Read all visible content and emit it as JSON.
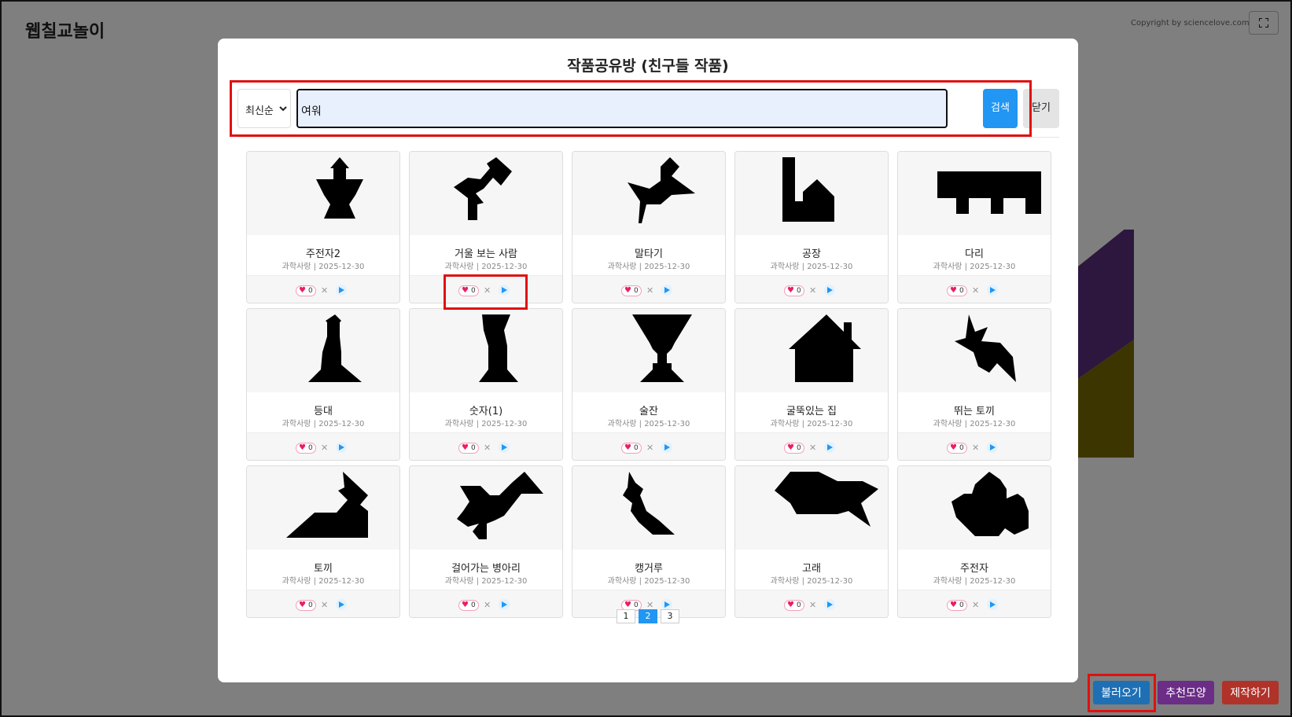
{
  "app": {
    "title": "웹칠교놀이",
    "copyright": "Copyright by sciencelove.com"
  },
  "bottom_buttons": {
    "load": "불러오기",
    "recommend": "추천모양",
    "make": "제작하기"
  },
  "modal": {
    "title": "작품공유방 (친구들 작품)",
    "sort_selected": "최신순",
    "search_value": "여워",
    "search_button": "검색",
    "close_button": "닫기"
  },
  "cards": [
    {
      "title": "주전자2",
      "author": "과학사랑",
      "date": "2025-12-30",
      "likes": "0",
      "icon": "shape-kettle2"
    },
    {
      "title": "거울 보는 사람",
      "author": "과학사랑",
      "date": "2025-12-30",
      "likes": "0",
      "icon": "shape-mirror-person"
    },
    {
      "title": "말타기",
      "author": "과학사랑",
      "date": "2025-12-30",
      "likes": "0",
      "icon": "shape-horse-riding"
    },
    {
      "title": "공장",
      "author": "과학사랑",
      "date": "2025-12-30",
      "likes": "0",
      "icon": "shape-factory"
    },
    {
      "title": "다리",
      "author": "과학사랑",
      "date": "2025-12-30",
      "likes": "0",
      "icon": "shape-bridge"
    },
    {
      "title": "등대",
      "author": "과학사랑",
      "date": "2025-12-30",
      "likes": "0",
      "icon": "shape-lighthouse"
    },
    {
      "title": "숫자(1)",
      "author": "과학사랑",
      "date": "2025-12-30",
      "likes": "0",
      "icon": "shape-number-one"
    },
    {
      "title": "술잔",
      "author": "과학사랑",
      "date": "2025-12-30",
      "likes": "0",
      "icon": "shape-goblet"
    },
    {
      "title": "굴뚝있는 집",
      "author": "과학사랑",
      "date": "2025-12-30",
      "likes": "0",
      "icon": "shape-house-chimney"
    },
    {
      "title": "뛰는 토끼",
      "author": "과학사랑",
      "date": "2025-12-30",
      "likes": "0",
      "icon": "shape-jumping-rabbit"
    },
    {
      "title": "토끼",
      "author": "과학사랑",
      "date": "2025-12-30",
      "likes": "0",
      "icon": "shape-rabbit"
    },
    {
      "title": "걸어가는 병아리",
      "author": "과학사랑",
      "date": "2025-12-30",
      "likes": "0",
      "icon": "shape-walking-chick"
    },
    {
      "title": "캥거루",
      "author": "과학사랑",
      "date": "2025-12-30",
      "likes": "0",
      "icon": "shape-kangaroo"
    },
    {
      "title": "고래",
      "author": "과학사랑",
      "date": "2025-12-30",
      "likes": "0",
      "icon": "shape-whale"
    },
    {
      "title": "주전자",
      "author": "과학사랑",
      "date": "2025-12-30",
      "likes": "0",
      "icon": "shape-kettle"
    }
  ],
  "pagination": {
    "pages": [
      "1",
      "2",
      "3"
    ],
    "current": "2"
  },
  "colors": {
    "search_button": "#2196f3",
    "load_button": "#1f6fb4",
    "recommend_button": "#6b2d86",
    "make_button": "#b03229",
    "highlight": "#e01010",
    "like_heart": "#e91e63"
  }
}
